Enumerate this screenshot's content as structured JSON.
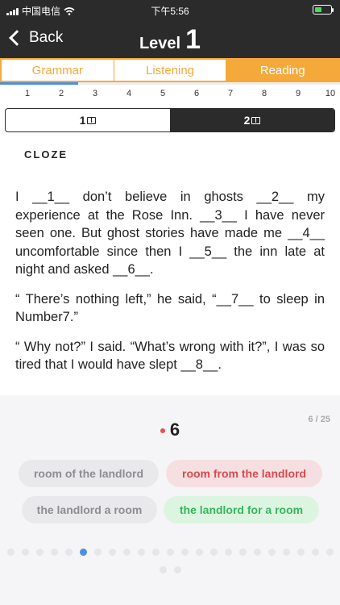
{
  "status": {
    "carrier": "中国电信",
    "time": "下午5:56"
  },
  "header": {
    "back_label": "Back",
    "title_word": "Level",
    "title_number": "1"
  },
  "tabs": [
    {
      "label": "Grammar",
      "active": false
    },
    {
      "label": "Listening",
      "active": false
    },
    {
      "label": "Reading",
      "active": true
    }
  ],
  "progress": {
    "fraction": 0.23
  },
  "numbers": [
    "1",
    "2",
    "3",
    "4",
    "5",
    "6",
    "7",
    "8",
    "9",
    "10"
  ],
  "toggle": [
    {
      "label": "1",
      "active": false
    },
    {
      "label": "2",
      "active": true
    }
  ],
  "section_label": "CLOZE",
  "passage": [
    "I __1__ don’t believe in ghosts __2__ my experience at the Rose Inn. __3__ I have never seen one. But ghost stories have made me __4__ uncomfortable since then I __5__ the inn late at night and asked __6__.",
    "“ There’s nothing left,” he said, “__7__ to sleep in Number7.”",
    "“ Why not?” I said. “What’s wrong with it?”, I was so tired that I would have slept __8__."
  ],
  "question": {
    "counter": "6 / 25",
    "number": "6"
  },
  "choices": [
    {
      "label": "room of the landlord",
      "state": "neutral"
    },
    {
      "label": "room from the landlord",
      "state": "wrong"
    },
    {
      "label": "the landlord a room",
      "state": "neutral"
    },
    {
      "label": "the landlord for a room",
      "state": "right"
    }
  ],
  "pager": {
    "total": 25,
    "current": 6
  }
}
